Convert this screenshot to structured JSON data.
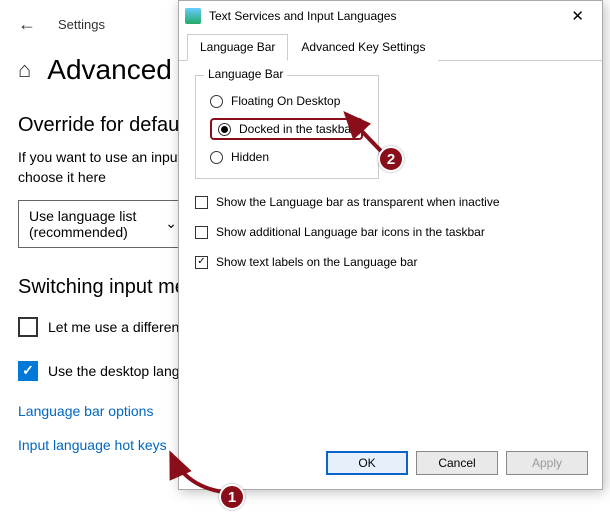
{
  "settings": {
    "window_label": "Settings",
    "heading": "Advanced",
    "section_override": "Override for default input method",
    "override_text": "If you want to use an input method that's different than the first one in your language list, choose it here",
    "dropdown_value": "Use language list (recommended)",
    "section_switch": "Switching input methods",
    "check_diff": "Let me use a different input method for each app window",
    "check_desktop": "Use the desktop language bar when it's available",
    "link_lang_bar": "Language bar options",
    "link_hot_keys": "Input language hot keys"
  },
  "dialog": {
    "title": "Text Services and Input Languages",
    "tabs": {
      "langbar": "Language Bar",
      "adv": "Advanced Key Settings"
    },
    "group_label": "Language Bar",
    "radio": {
      "floating": "Floating On Desktop",
      "docked": "Docked in the taskbar",
      "hidden": "Hidden"
    },
    "checks": {
      "transparent": "Show the Language bar as transparent when inactive",
      "icons": "Show additional Language bar icons in the taskbar",
      "labels": "Show text labels on the Language bar"
    },
    "buttons": {
      "ok": "OK",
      "cancel": "Cancel",
      "apply": "Apply"
    }
  },
  "callouts": {
    "one": "1",
    "two": "2"
  }
}
